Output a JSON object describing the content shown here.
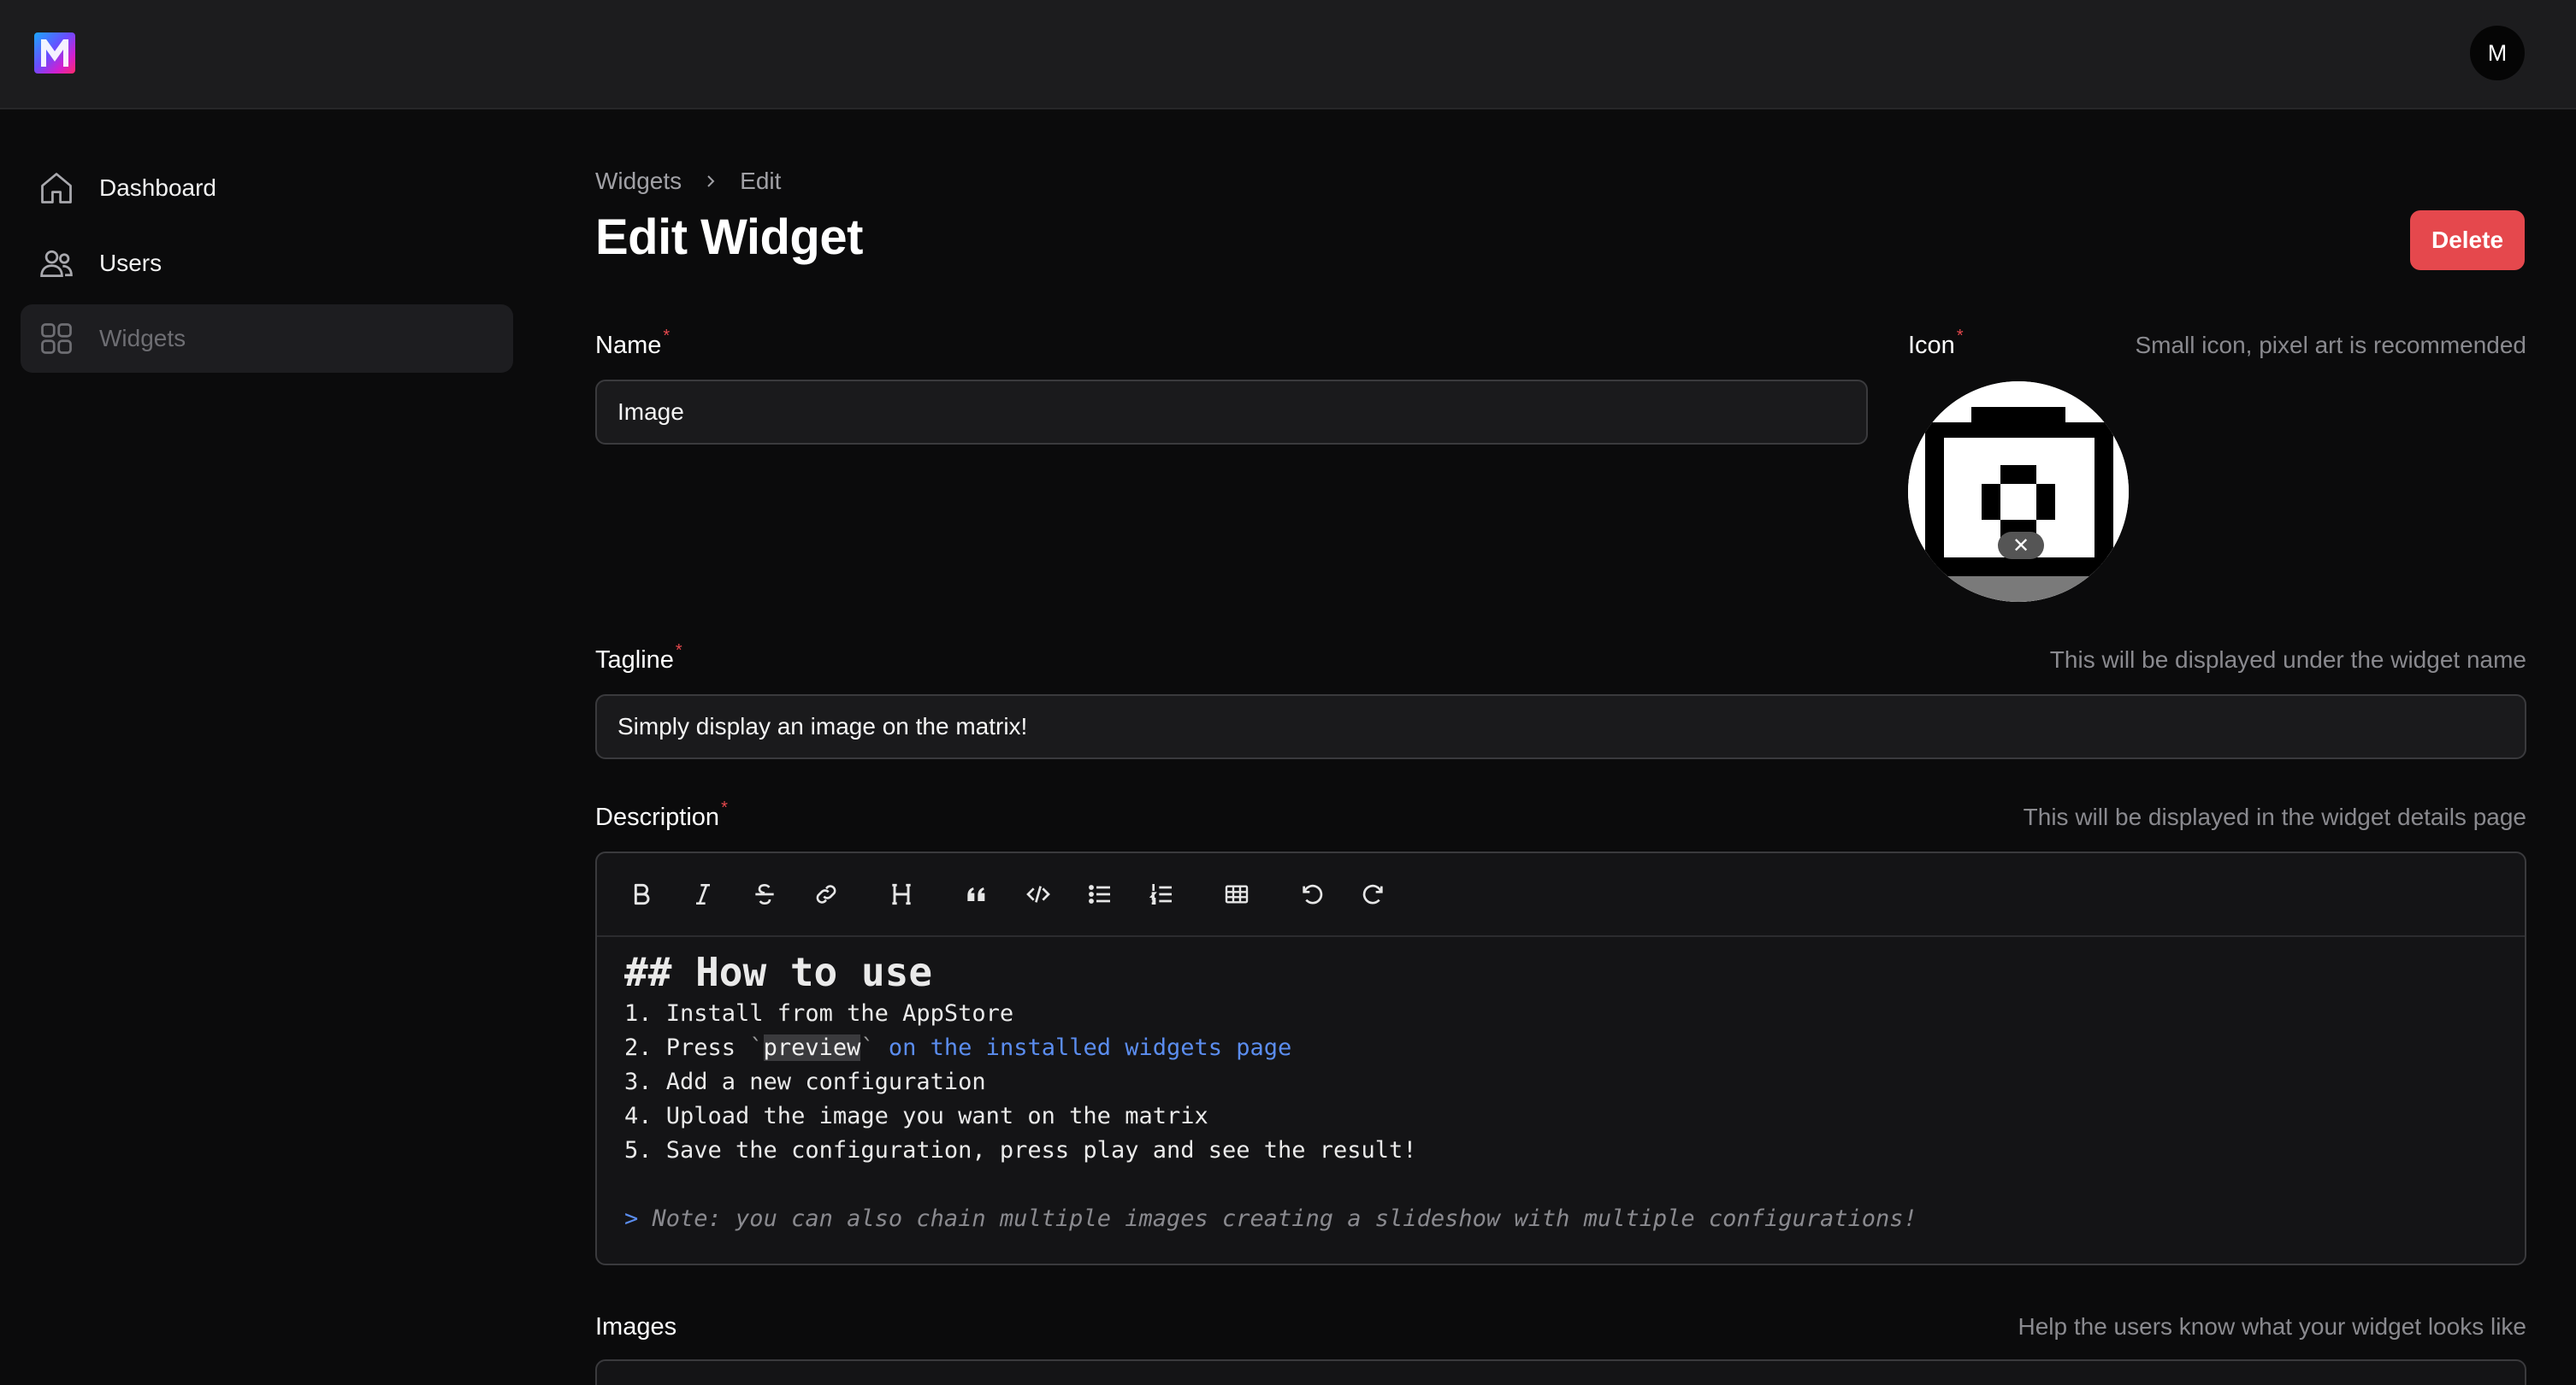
{
  "header": {
    "logo_letter": "M",
    "avatar_initial": "M"
  },
  "sidebar": {
    "items": [
      {
        "label": "Dashboard",
        "icon": "home-icon",
        "active": false
      },
      {
        "label": "Users",
        "icon": "users-icon",
        "active": false
      },
      {
        "label": "Widgets",
        "icon": "grid-icon",
        "active": true
      }
    ]
  },
  "breadcrumb": [
    "Widgets",
    "Edit"
  ],
  "page": {
    "title": "Edit Widget",
    "delete_label": "Delete"
  },
  "form": {
    "name": {
      "label": "Name",
      "value": "Image"
    },
    "icon": {
      "label": "Icon",
      "hint": "Small icon, pixel art is recommended",
      "clear_symbol": "✕"
    },
    "tagline": {
      "label": "Tagline",
      "hint": "This will be displayed under the widget name",
      "value": "Simply display an image on the matrix!"
    },
    "description": {
      "label": "Description",
      "hint": "This will be displayed in the widget details page",
      "toolbar": [
        "bold-icon",
        "italic-icon",
        "strikethrough-icon",
        "link-icon",
        "heading-icon",
        "quote-icon",
        "code-icon",
        "bullet-list-icon",
        "ordered-list-icon",
        "table-icon",
        "undo-icon",
        "redo-icon"
      ],
      "content": {
        "heading": "## How to use",
        "line1": "1. Install from the AppStore",
        "line2_prefix": "2. Press ",
        "line2_code": "preview",
        "line2_suffix": " on the installed widgets page",
        "line3": "3. Add a new configuration",
        "line4": "4. Upload the image you want on the matrix",
        "line5": "5. Save the configuration, press play and see the result!",
        "quote_mark": ">",
        "quote_text": " Note: you can also chain multiple images creating a slideshow with multiple configurations!"
      }
    },
    "images": {
      "label": "Images",
      "hint": "Help the users know what your widget looks like"
    }
  },
  "colors": {
    "accent_red": "#e5484d",
    "link_blue": "#5b8def",
    "background": "#0b0b0c",
    "topbar": "#1c1c1e"
  }
}
